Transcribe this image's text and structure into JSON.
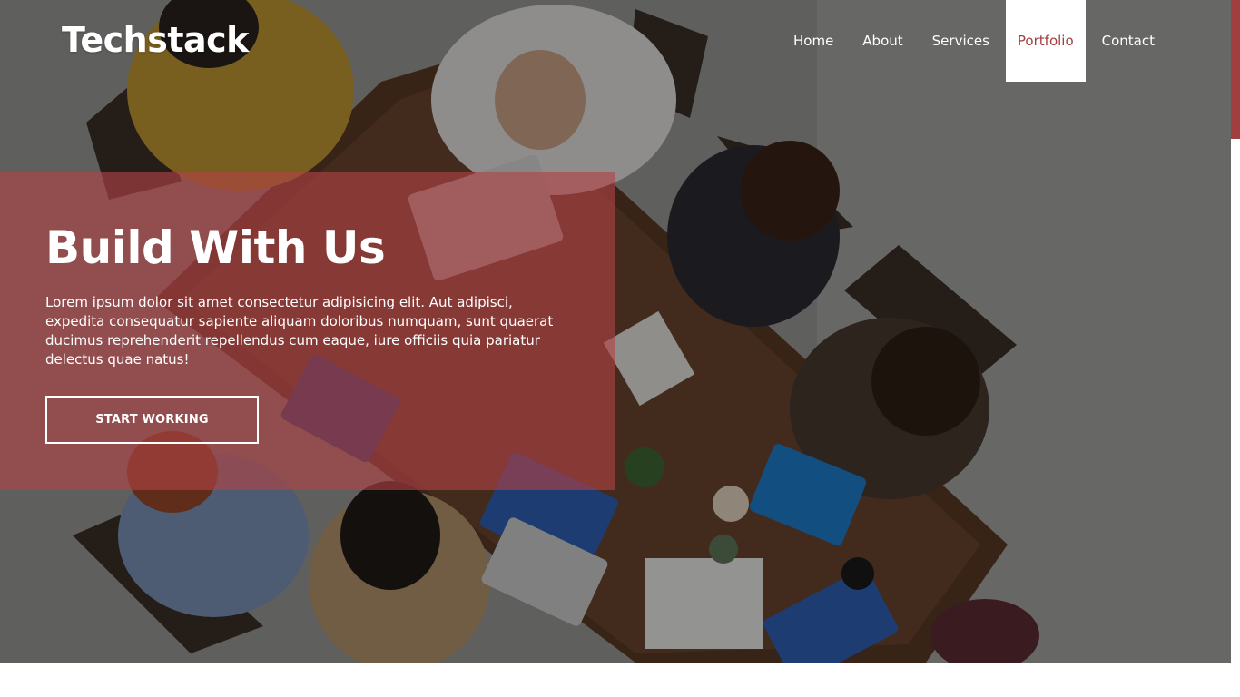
{
  "brand": {
    "logo": "Techstack"
  },
  "nav": {
    "items": [
      {
        "label": "Home"
      },
      {
        "label": "About"
      },
      {
        "label": "Services"
      },
      {
        "label": "Portfolio"
      },
      {
        "label": "Contact"
      }
    ],
    "active": "Portfolio"
  },
  "hero": {
    "title": "Build With Us",
    "text": "Lorem ipsum dolor sit amet consectetur adipisicing elit. Aut adipisci, expedita consequatur sapiente aliquam doloribus numquam, sunt quaerat ducimus reprehenderit repellendus cum eaque, iure officiis quia pariatur delectus quae natus!",
    "cta_label": "START WORKING"
  },
  "colors": {
    "accent": "#a13e40",
    "overlay": "#b24246",
    "text": "#ffffff"
  }
}
